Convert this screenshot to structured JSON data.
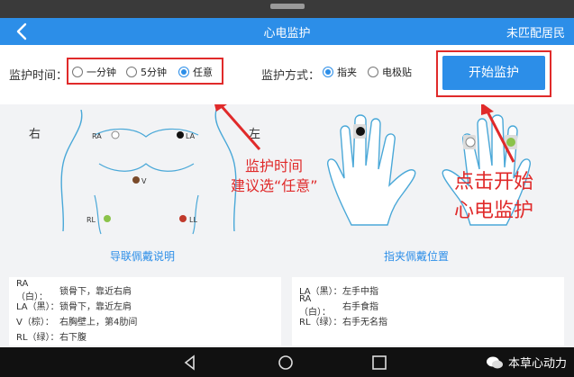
{
  "header": {
    "title": "心电监护",
    "right_label": "未匹配居民"
  },
  "controls": {
    "time_label": "监护时间：",
    "time_options": [
      "一分钟",
      "5分钟",
      "任意"
    ],
    "mode_label": "监护方式：",
    "mode_options": [
      "指夹",
      "电极贴"
    ],
    "start_button": "开始监护"
  },
  "figure": {
    "side_right": "右",
    "side_left": "左",
    "points": {
      "ra": "RA",
      "la": "LA",
      "v": "V",
      "rl": "RL",
      "ll": "LL"
    },
    "caption_leads": "导联佩戴说明",
    "caption_clip": "指夹佩戴位置"
  },
  "annotations": {
    "time_tip_line1": "监护时间",
    "time_tip_line2": "建议选“任意”",
    "start_tip_line1": "点击开始",
    "start_tip_line2": "心电监护"
  },
  "lead_notes": [
    {
      "k": "RA（白）：",
      "v": "锁骨下，靠近右肩"
    },
    {
      "k": "LA（黑）：",
      "v": "锁骨下，靠近左肩"
    },
    {
      "k": "V（棕）：",
      "v": "右胸壁上，第4肋间"
    },
    {
      "k": "RL（绿）：",
      "v": "右下腹"
    }
  ],
  "clip_notes": [
    {
      "k": "LA（黑）：",
      "v": "左手中指"
    },
    {
      "k": "RA（白）：",
      "v": "右手食指"
    },
    {
      "k": "RL（绿）：",
      "v": "右手无名指"
    }
  ],
  "watermark": "本草心动力",
  "colors": {
    "primary": "#2c8ee8",
    "annotation": "#e02a2a",
    "green": "#8bc34a",
    "brown": "#7a4a2a",
    "red": "#c0392b"
  }
}
